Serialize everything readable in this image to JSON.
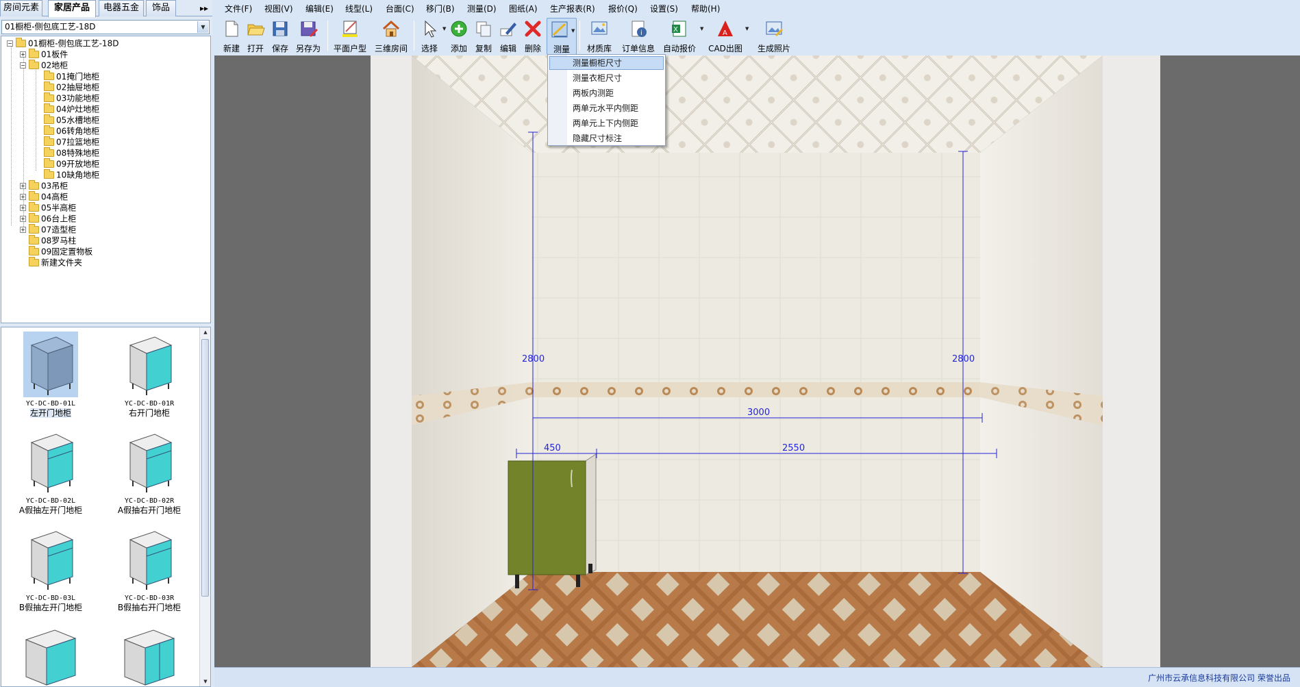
{
  "panel_tabs": [
    "房间元素",
    "家居产品",
    "电器五金",
    "饰品"
  ],
  "panel_tabs_more": "▸▸",
  "category_select": {
    "value": "01橱柜-侧包底工艺-18D"
  },
  "tree": {
    "root": "01橱柜-侧包底工艺-18D",
    "nodes": [
      {
        "label": "01板件",
        "expander": "+"
      },
      {
        "label": "02地柜",
        "expander": "−"
      },
      {
        "label": "01掩门地柜"
      },
      {
        "label": "02抽屉地柜"
      },
      {
        "label": "03功能地柜"
      },
      {
        "label": "04炉灶地柜"
      },
      {
        "label": "05水槽地柜"
      },
      {
        "label": "06转角地柜"
      },
      {
        "label": "07拉篮地柜"
      },
      {
        "label": "08特殊地柜"
      },
      {
        "label": "09开放地柜"
      },
      {
        "label": "10缺角地柜"
      },
      {
        "label": "03吊柜",
        "expander": "+"
      },
      {
        "label": "04高柜",
        "expander": "+"
      },
      {
        "label": "05半高柜",
        "expander": "+"
      },
      {
        "label": "06台上柜",
        "expander": "+"
      },
      {
        "label": "07造型柜",
        "expander": "+"
      },
      {
        "label": "08罗马柱"
      },
      {
        "label": "09固定置物板"
      },
      {
        "label": "新建文件夹"
      }
    ]
  },
  "thumbnails": [
    {
      "code": "YC-DC-BD-01L",
      "name": "左开门地柜",
      "selected": true
    },
    {
      "code": "YC-DC-BD-01R",
      "name": "右开门地柜"
    },
    {
      "code": "YC-DC-BD-02L",
      "name": "A假抽左开门地柜"
    },
    {
      "code": "YC-DC-BD-02R",
      "name": "A假抽右开门地柜"
    },
    {
      "code": "YC-DC-BD-03L",
      "name": "B假抽左开门地柜"
    },
    {
      "code": "YC-DC-BD-03R",
      "name": "B假抽右开门地柜"
    },
    {
      "code": "",
      "name": ""
    },
    {
      "code": "",
      "name": ""
    }
  ],
  "menu": [
    "文件(F)",
    "视图(V)",
    "编辑(E)",
    "线型(L)",
    "台面(C)",
    "移门(B)",
    "测量(D)",
    "图纸(A)",
    "生产报表(R)",
    "报价(Q)",
    "设置(S)",
    "帮助(H)"
  ],
  "toolbar": {
    "new": "新建",
    "open": "打开",
    "save": "保存",
    "save_as": "另存为",
    "floor_plan": "平面户型",
    "room_3d": "三维房间",
    "select": "选择",
    "add": "添加",
    "copy": "复制",
    "edit": "编辑",
    "delete": "删除",
    "measure": "测量",
    "material_lib": "材质库",
    "order_info": "订单信息",
    "auto_quote": "自动报价",
    "cad_export": "CAD出图",
    "render_photo": "生成照片"
  },
  "measure_menu": {
    "items": [
      "测量橱柜尺寸",
      "测量衣柜尺寸",
      "两板内测距",
      "两单元水平内侧距",
      "两单元上下内侧距",
      "隐藏尺寸标注"
    ],
    "highlighted_index": 0
  },
  "dimensions": {
    "left_height": "2800",
    "right_height": "2800",
    "room_width": "3000",
    "cabinet_width": "450",
    "remaining_width": "2550"
  },
  "colors": {
    "dimension_line": "#2323d8",
    "cabinet_front": "#73832a",
    "menu_highlight": "#c6dcf6",
    "thumbnail_door": "#43d0d0"
  },
  "status_bar": {
    "text": "广州市云承信息科技有限公司 荣誉出品"
  }
}
